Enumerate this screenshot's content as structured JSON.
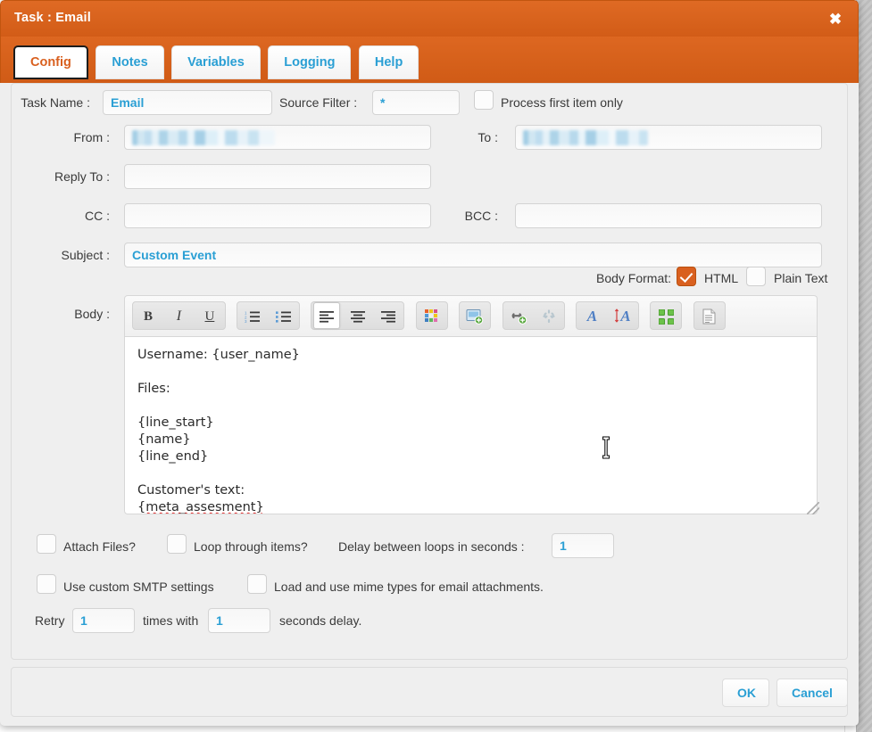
{
  "window": {
    "title": "Task : Email",
    "close_icon": "close-icon"
  },
  "tabs": [
    {
      "label": "Config",
      "active": true
    },
    {
      "label": "Notes",
      "active": false
    },
    {
      "label": "Variables",
      "active": false
    },
    {
      "label": "Logging",
      "active": false
    },
    {
      "label": "Help",
      "active": false
    }
  ],
  "form": {
    "task_name_label": "Task Name :",
    "task_name_value": "Email",
    "source_filter_label": "Source Filter :",
    "source_filter_value": "*",
    "process_first_item_label": "Process first item only",
    "process_first_item_checked": false,
    "from_label": "From :",
    "from_value": "",
    "from_redacted": true,
    "to_label": "To :",
    "to_value": "",
    "to_redacted": true,
    "reply_to_label": "Reply To :",
    "reply_to_value": "",
    "cc_label": "CC :",
    "cc_value": "",
    "bcc_label": "BCC :",
    "bcc_value": "",
    "subject_label": "Subject :",
    "subject_value": "Custom Event",
    "body_label": "Body :"
  },
  "body_format": {
    "label": "Body Format:",
    "html_label": "HTML",
    "html_checked": true,
    "plain_text_label": "Plain Text",
    "plain_text_checked": false
  },
  "editor": {
    "toolbar": [
      {
        "name": "bold-icon",
        "glyph": "B",
        "active": false
      },
      {
        "name": "italic-icon",
        "glyph": "I",
        "active": false
      },
      {
        "name": "underline-icon",
        "glyph": "U",
        "active": false
      },
      {
        "name": "ordered-list-icon",
        "glyph": "",
        "active": false
      },
      {
        "name": "unordered-list-icon",
        "glyph": "",
        "active": false
      },
      {
        "name": "align-left-icon",
        "glyph": "",
        "active": true
      },
      {
        "name": "align-center-icon",
        "glyph": "",
        "active": false
      },
      {
        "name": "align-right-icon",
        "glyph": "",
        "active": false
      },
      {
        "name": "color-palette-icon",
        "glyph": "",
        "active": false
      },
      {
        "name": "insert-image-icon",
        "glyph": "",
        "active": false
      },
      {
        "name": "insert-link-icon",
        "glyph": "",
        "active": false
      },
      {
        "name": "unlink-icon",
        "glyph": "",
        "active": false
      },
      {
        "name": "font-color-icon",
        "glyph": "A",
        "active": false
      },
      {
        "name": "font-size-icon",
        "glyph": "A",
        "active": false
      },
      {
        "name": "fullscreen-icon",
        "glyph": "",
        "active": false
      },
      {
        "name": "source-view-icon",
        "glyph": "",
        "active": false
      }
    ],
    "content_lines": [
      "Username: {user_name}",
      "",
      "Files:",
      "",
      "{line_start}",
      "{name}",
      "{line_end}",
      "",
      "Customer's text:",
      "{meta_assesment}"
    ],
    "misspelled_word": "{meta_assesment}"
  },
  "options": {
    "attach_files_label": "Attach Files?",
    "attach_files_checked": false,
    "loop_through_items_label": "Loop through items?",
    "loop_through_items_checked": false,
    "delay_between_loops_label": "Delay between loops in seconds :",
    "delay_between_loops_value": "1",
    "use_custom_smtp_label": "Use custom SMTP settings",
    "use_custom_smtp_checked": false,
    "load_mime_types_label": "Load and use mime types for email attachments.",
    "load_mime_types_checked": false,
    "retry_prefix_label": "Retry",
    "retry_times_value": "1",
    "retry_mid_label": "times with",
    "retry_delay_value": "1",
    "retry_suffix_label": "seconds delay."
  },
  "footer": {
    "ok_label": "OK",
    "cancel_label": "Cancel"
  },
  "colors": {
    "accent_orange": "#d9601f",
    "link_blue": "#2a9fd4",
    "panel_gray": "#efefef"
  }
}
